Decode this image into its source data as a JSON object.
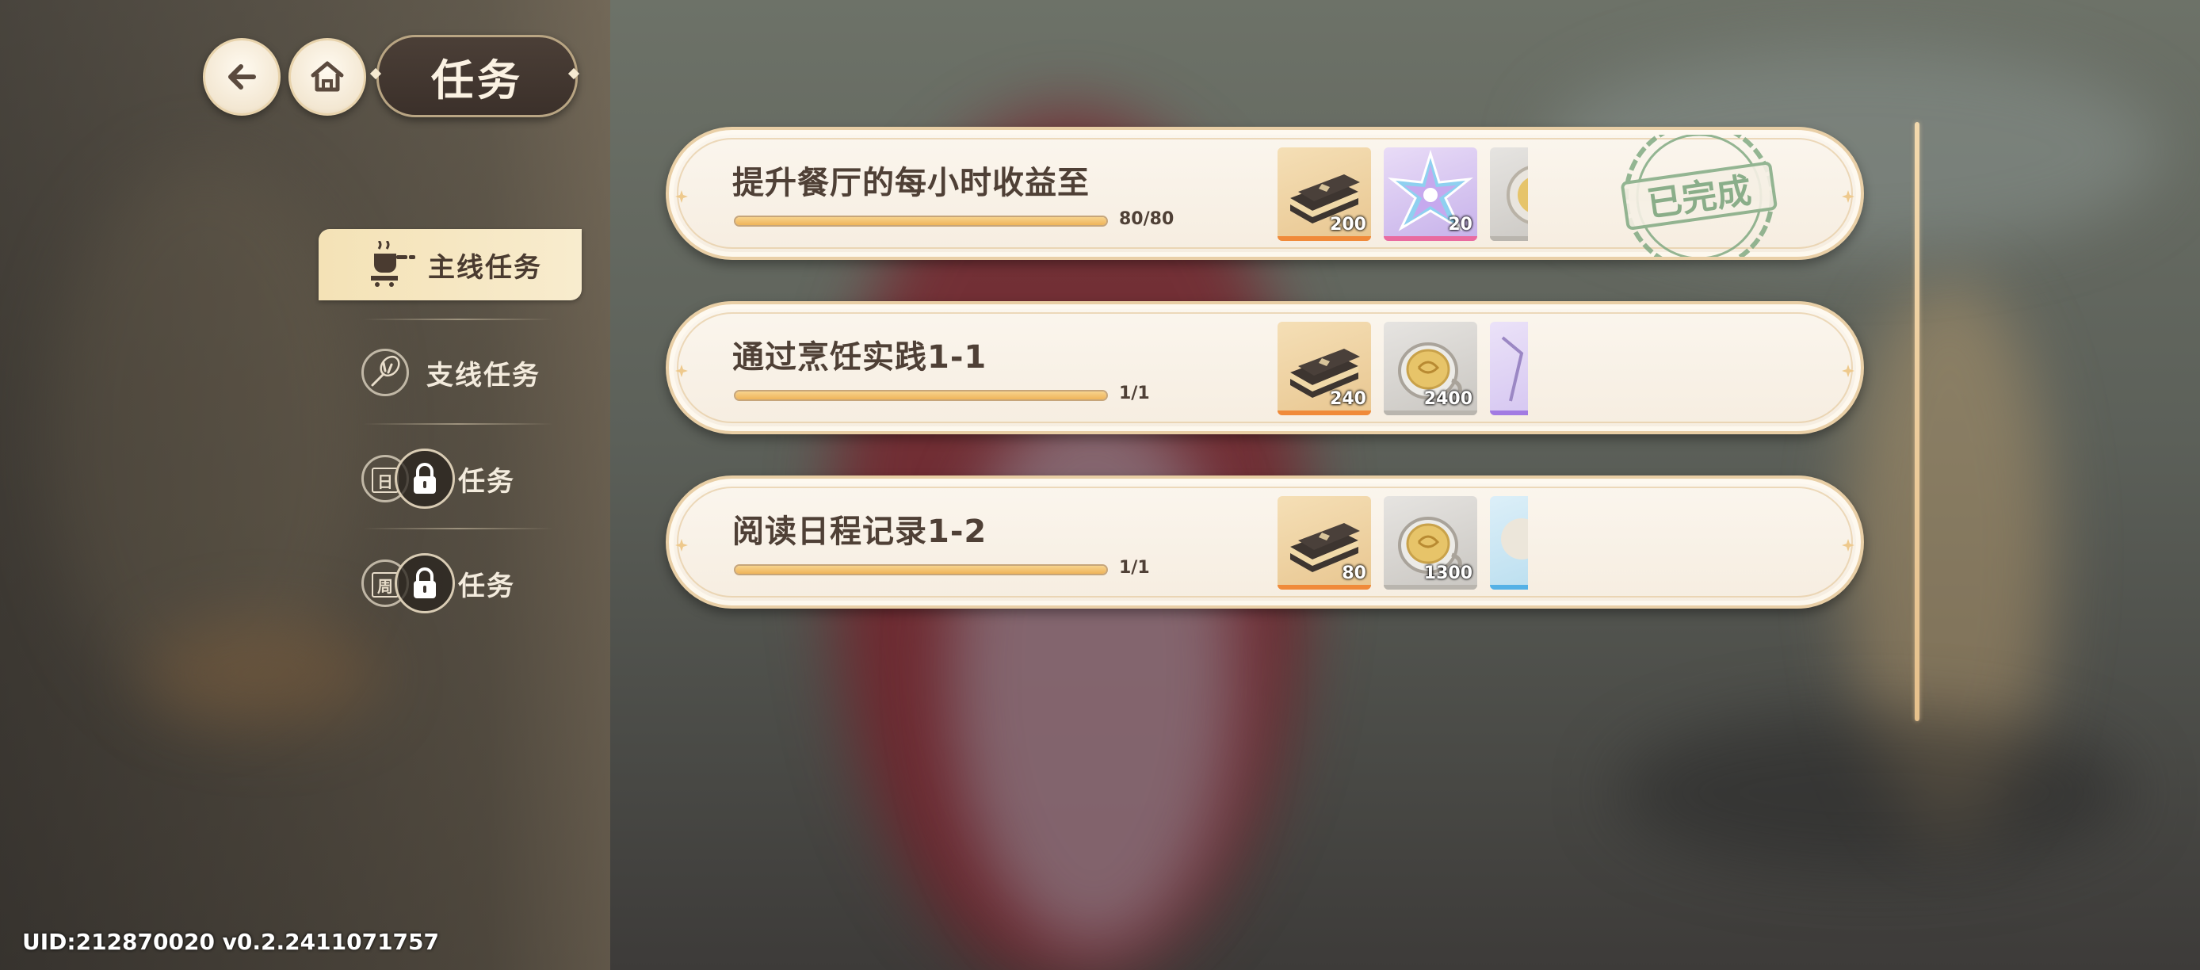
{
  "header": {
    "title": "任务"
  },
  "tabs": [
    {
      "label": "主线任务",
      "icon": "pot-icon",
      "active": true
    },
    {
      "label": "支线任务",
      "icon": "whisk-icon",
      "active": false
    },
    {
      "label": "任务",
      "icon": "calendar-day-icon",
      "calendar_char": "日",
      "locked": true
    },
    {
      "label": "任务",
      "icon": "calendar-week-icon",
      "calendar_char": "周",
      "locked": true
    }
  ],
  "quests": [
    {
      "title": "提升餐厅的每小时收益至",
      "progress_text": "80/80",
      "progress": 1.0,
      "rewards": [
        {
          "icon": "book-icon",
          "qty": "200",
          "rarity": "gold"
        },
        {
          "icon": "star-crystal-icon",
          "qty": "20",
          "rarity": "purple"
        },
        {
          "icon": "coin-icon",
          "qty": "",
          "rarity": "grey"
        }
      ],
      "completed": true,
      "stamp_text": "已完成"
    },
    {
      "title": "通过烹饪实践1-1",
      "progress_text": "1/1",
      "progress": 1.0,
      "rewards": [
        {
          "icon": "book-icon",
          "qty": "240",
          "rarity": "gold"
        },
        {
          "icon": "coin-icon",
          "qty": "2400",
          "rarity": "grey"
        },
        {
          "icon": "scroll-icon",
          "qty": "",
          "rarity": "violet"
        }
      ],
      "completed": false
    },
    {
      "title": "阅读日程记录1-2",
      "progress_text": "1/1",
      "progress": 1.0,
      "rewards": [
        {
          "icon": "book-icon",
          "qty": "80",
          "rarity": "gold"
        },
        {
          "icon": "coin-icon",
          "qty": "1300",
          "rarity": "grey"
        },
        {
          "icon": "plate-icon",
          "qty": "",
          "rarity": "blue"
        }
      ],
      "completed": false
    }
  ],
  "footer": {
    "uid_text": "UID:212870020  v0.2.2411071757"
  }
}
